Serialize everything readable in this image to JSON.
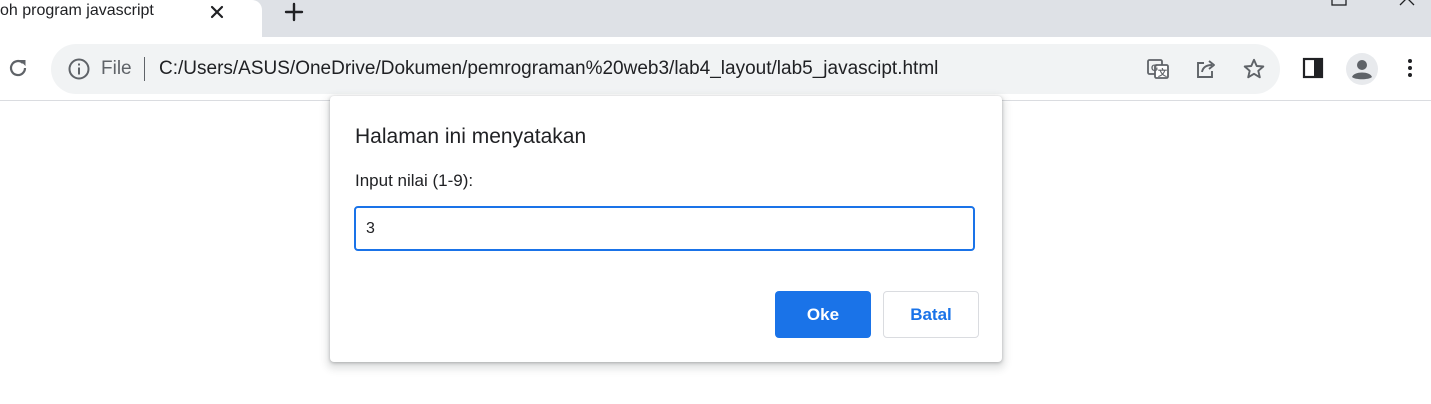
{
  "tab": {
    "title": "oh program javascript"
  },
  "toolbar": {
    "scheme_label": "File",
    "url": "C:/Users/ASUS/OneDrive/Dokumen/pemrograman%20web3/lab4_layout/lab5_javascipt.html"
  },
  "dialog": {
    "title": "Halaman ini menyatakan",
    "message": "Input nilai (1-9):",
    "input_value": "3",
    "ok_label": "Oke",
    "cancel_label": "Batal"
  },
  "icons": {
    "close": "close-icon",
    "new_tab": "plus-icon",
    "reload": "reload-icon",
    "info": "info-icon",
    "translate": "translate-icon",
    "share": "share-icon",
    "bookmark": "star-icon",
    "side_panel": "side-panel-icon",
    "profile": "profile-avatar-icon",
    "menu": "kebab-menu-icon"
  },
  "colors": {
    "accent": "#1a73e8",
    "tabstrip": "#dee1e6",
    "omnibox": "#f1f3f4"
  }
}
